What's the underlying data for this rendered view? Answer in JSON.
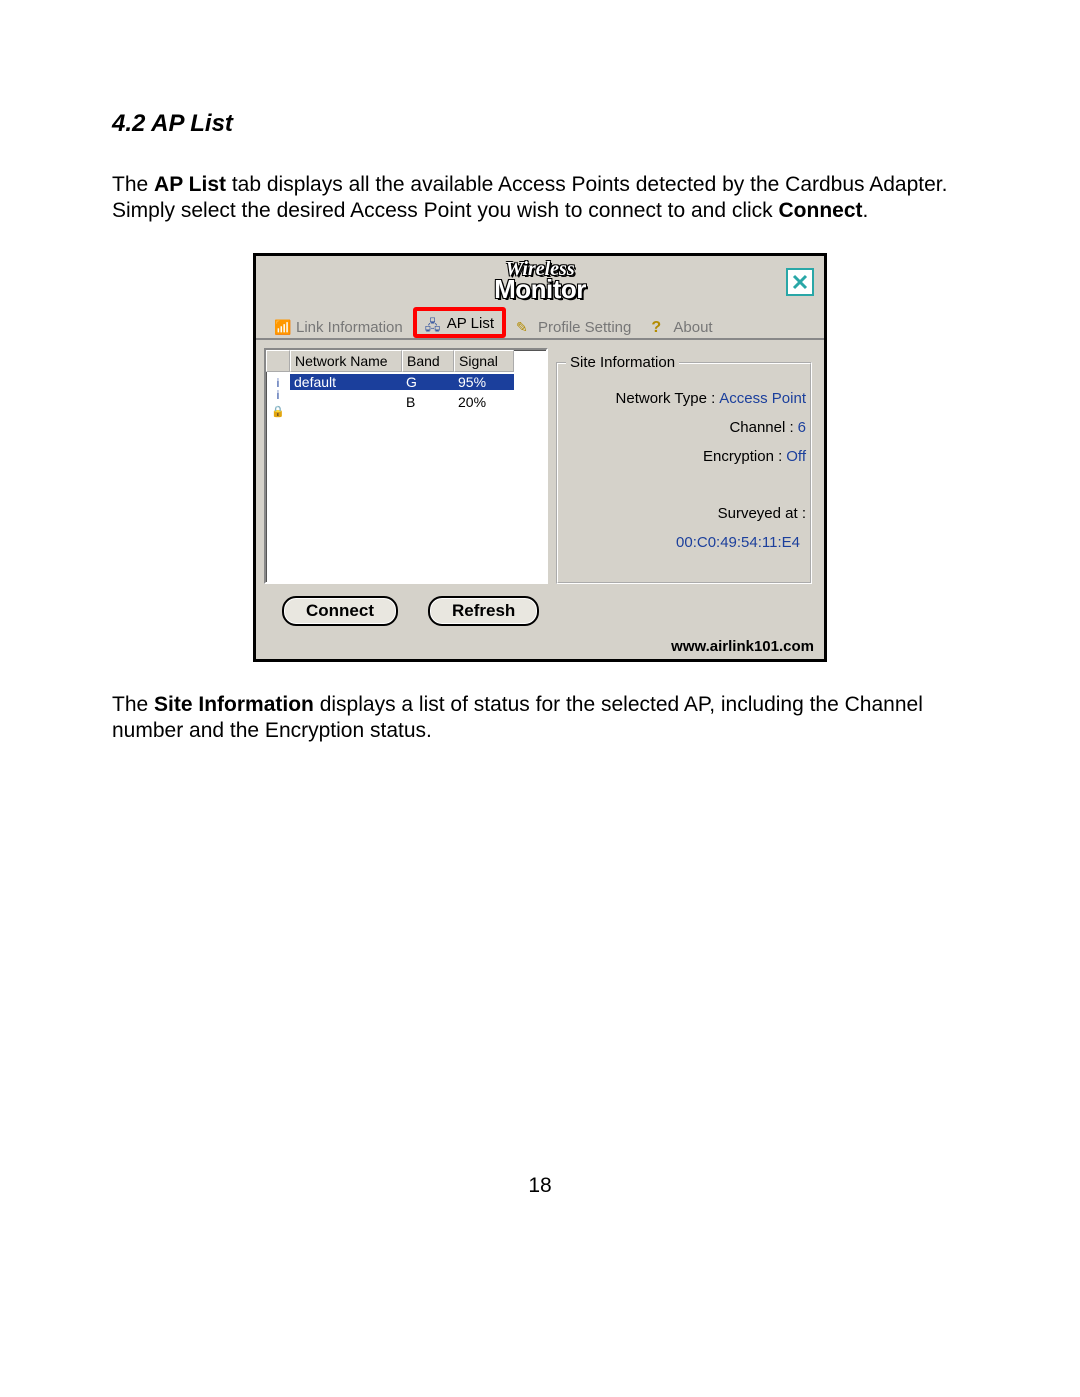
{
  "heading": "4.2 AP List",
  "para1": {
    "pre": "The ",
    "b1": "AP List",
    "mid": " tab displays all the available Access Points detected by the Cardbus Adapter. Simply select the desired Access Point you wish to connect to and click ",
    "b2": "Connect",
    "post": "."
  },
  "app": {
    "logo1": "Wireless",
    "logo2": "Monitor",
    "closeGlyph": "X",
    "tabs": {
      "link": "Link Information",
      "ap": "AP List",
      "profile": "Profile Setting",
      "about": "About"
    },
    "columns": {
      "name": "Network Name",
      "band": "Band",
      "signal": "Signal"
    },
    "rows": [
      {
        "secured": false,
        "name": "default",
        "band": "G",
        "signal": "95%",
        "selected": true
      },
      {
        "secured": true,
        "name": "",
        "band": "B",
        "signal": "20%",
        "selected": false
      }
    ],
    "siteLegend": "Site Information",
    "siteInfo": {
      "networkTypeLabel": "Network Type :",
      "networkType": "Access Point",
      "channelLabel": "Channel :",
      "channel": "6",
      "encryptionLabel": "Encryption :",
      "encryption": "Off",
      "surveyedLabel": "Surveyed at :",
      "mac": "00:C0:49:54:11:E4"
    },
    "buttons": {
      "connect": "Connect",
      "refresh": "Refresh"
    },
    "footerUrl": "www.airlink101.com"
  },
  "para2": {
    "pre": "The ",
    "b1": "Site Information",
    "post": " displays a list of status for the selected AP, including the Channel number and the Encryption status."
  },
  "pageNumber": "18"
}
